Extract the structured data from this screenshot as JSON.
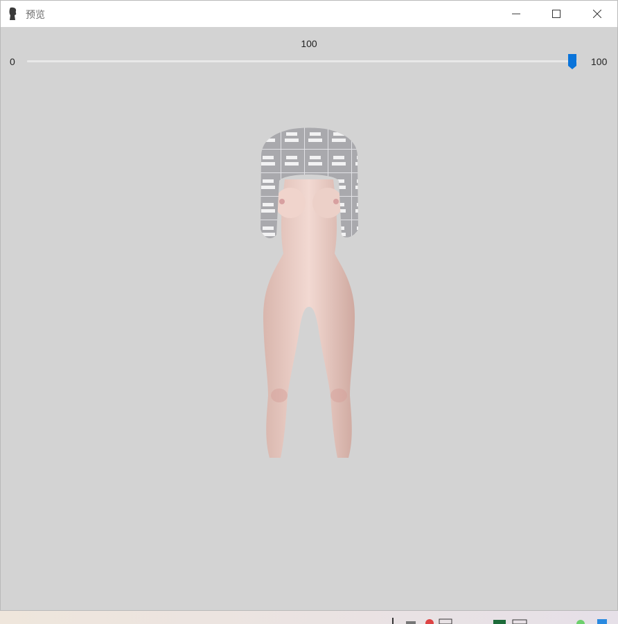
{
  "window": {
    "title": "预览",
    "app_icon": "app-icon",
    "controls": {
      "minimize_icon": "minimize-icon",
      "maximize_icon": "maximize-icon",
      "close_icon": "close-icon"
    }
  },
  "slider": {
    "current_value_label": "100",
    "min_label": "0",
    "max_label": "100",
    "value": 100,
    "min": 0,
    "max": 100,
    "accent_color": "#0a74da"
  },
  "viewport": {
    "background_color": "#d3d3d3",
    "content": "3d-model-preview"
  },
  "taskbar": {
    "tray_icons": [
      "tray-icon-1",
      "tray-icon-2",
      "tray-icon-3",
      "tray-icon-4",
      "tray-icon-5",
      "tray-icon-6",
      "tray-icon-7"
    ]
  }
}
